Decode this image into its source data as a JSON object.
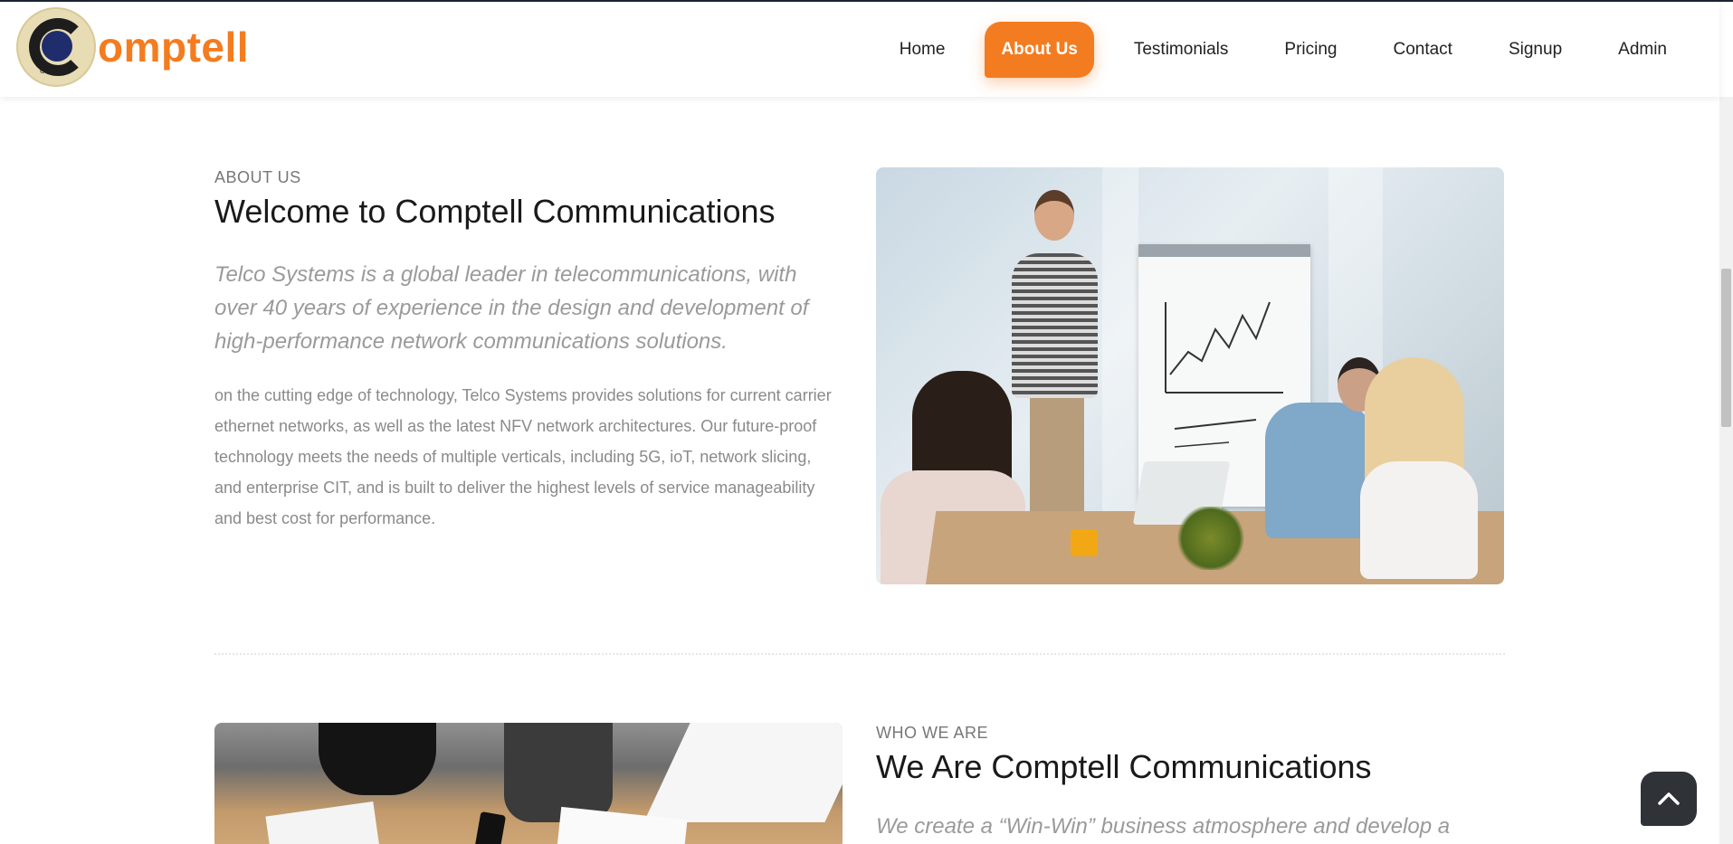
{
  "brand": {
    "logo_text": "omptell",
    "logo_badge_text": "Comptell",
    "accent": "#f47c20",
    "dark": "#2f3236"
  },
  "nav": {
    "items": [
      {
        "label": "Home",
        "active": false
      },
      {
        "label": "About Us",
        "active": true
      },
      {
        "label": "Testimonials",
        "active": false
      },
      {
        "label": "Pricing",
        "active": false
      },
      {
        "label": "Contact",
        "active": false
      },
      {
        "label": "Signup",
        "active": false
      },
      {
        "label": "Admin",
        "active": false
      }
    ]
  },
  "about": {
    "eyebrow": "ABOUT US",
    "title": "Welcome to Comptell Communications",
    "lead": "Telco Systems is a global leader in telecommunications, with over 40 years of experience in the design and development of high-performance network communications solutions.",
    "body": "on the cutting edge of technology, Telco Systems provides solutions for current carrier ethernet networks, as well as the latest NFV network architectures. Our future-proof technology meets the needs of multiple verticals, including 5G, ioT, network slicing, and enterprise CIT, and is built to deliver the highest levels of service manageability and best cost for performance."
  },
  "who": {
    "eyebrow": "WHO WE ARE",
    "title": "We Are Comptell Communications",
    "lead": "We create a “Win-Win” business atmosphere and develop a"
  },
  "icons": {
    "back_to_top": "chevron-up-icon"
  }
}
